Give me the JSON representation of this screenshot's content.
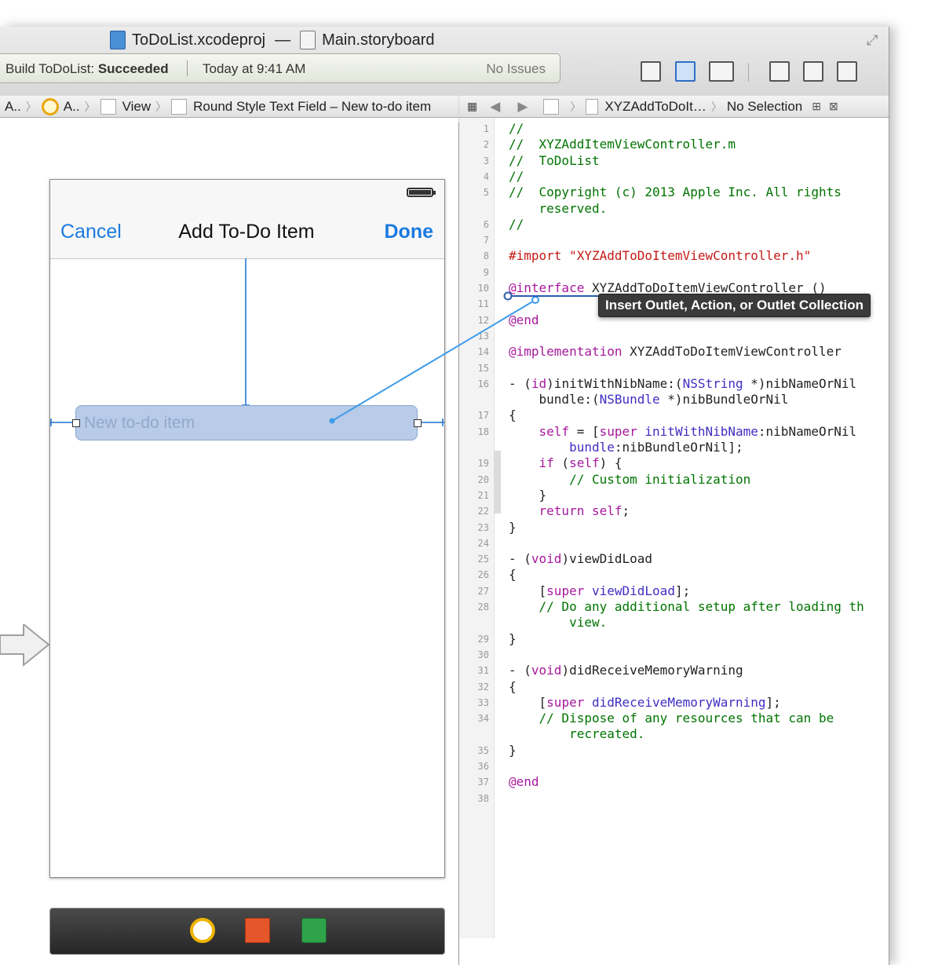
{
  "title": {
    "project": "ToDoList.xcodeproj",
    "separator": "—",
    "file": "Main.storyboard"
  },
  "activity": {
    "build_prefix": "Build ToDoList: ",
    "build_status": "Succeeded",
    "time": "Today at 9:41 AM",
    "issues": "No Issues"
  },
  "jumpbar_left": {
    "items": [
      "A..",
      "A..",
      "View",
      "Round Style Text Field – New to-do item"
    ]
  },
  "jumpbar_right": {
    "file": "XYZAddToDoIt…",
    "selection": "No Selection"
  },
  "scene": {
    "cancel": "Cancel",
    "title": "Add To-Do Item",
    "done": "Done",
    "textfield_placeholder": "New to-do item"
  },
  "tooltip": "Insert Outlet, Action, or Outlet Collection",
  "colors": {
    "keyword": "#a6199c",
    "string": "#c41a16",
    "comment": "#007400",
    "type": "#3f2ec2",
    "link": "#1a7ae0"
  },
  "code": [
    {
      "n": "1",
      "t": [
        {
          "s": "//",
          "c": "comment"
        }
      ]
    },
    {
      "n": "2",
      "t": [
        {
          "s": "//  XYZAddItemViewController.m",
          "c": "comment"
        }
      ]
    },
    {
      "n": "3",
      "t": [
        {
          "s": "//  ToDoList",
          "c": "comment"
        }
      ]
    },
    {
      "n": "4",
      "t": [
        {
          "s": "//",
          "c": "comment"
        }
      ]
    },
    {
      "n": "5",
      "t": [
        {
          "s": "//  Copyright (c) 2013 Apple Inc. All rights",
          "c": "comment"
        }
      ]
    },
    {
      "n": "",
      "t": [
        {
          "s": "    reserved.",
          "c": "comment"
        }
      ]
    },
    {
      "n": "6",
      "t": [
        {
          "s": "//",
          "c": "comment"
        }
      ]
    },
    {
      "n": "7",
      "t": []
    },
    {
      "n": "8",
      "t": [
        {
          "s": "#import ",
          "c": "string"
        },
        {
          "s": "\"XYZAddToDoItemViewController.h\"",
          "c": "string"
        }
      ]
    },
    {
      "n": "9",
      "t": []
    },
    {
      "n": "10",
      "t": [
        {
          "s": "@interface",
          "c": "keyword"
        },
        {
          "s": " XYZAddToDoItemViewController ()",
          "c": "plain"
        }
      ]
    },
    {
      "n": "11",
      "t": []
    },
    {
      "n": "12",
      "t": [
        {
          "s": "@end",
          "c": "keyword"
        }
      ]
    },
    {
      "n": "13",
      "t": []
    },
    {
      "n": "14",
      "t": [
        {
          "s": "@implementation",
          "c": "keyword"
        },
        {
          "s": " XYZAddToDoItemViewController",
          "c": "plain"
        }
      ]
    },
    {
      "n": "15",
      "t": []
    },
    {
      "n": "16",
      "t": [
        {
          "s": "- (",
          "c": "plain"
        },
        {
          "s": "id",
          "c": "keyword"
        },
        {
          "s": ")initWithNibName:(",
          "c": "plain"
        },
        {
          "s": "NSString",
          "c": "type"
        },
        {
          "s": " *)nibNameOrNil",
          "c": "plain"
        }
      ]
    },
    {
      "n": "",
      "t": [
        {
          "s": "    bundle:(",
          "c": "plain"
        },
        {
          "s": "NSBundle",
          "c": "type"
        },
        {
          "s": " *)nibBundleOrNil",
          "c": "plain"
        }
      ]
    },
    {
      "n": "17",
      "t": [
        {
          "s": "{",
          "c": "plain"
        }
      ]
    },
    {
      "n": "18",
      "t": [
        {
          "s": "    ",
          "c": "plain"
        },
        {
          "s": "self",
          "c": "keyword"
        },
        {
          "s": " = [",
          "c": "plain"
        },
        {
          "s": "super",
          "c": "keyword"
        },
        {
          "s": " ",
          "c": "plain"
        },
        {
          "s": "initWithNibName",
          "c": "type"
        },
        {
          "s": ":nibNameOrNil",
          "c": "plain"
        }
      ]
    },
    {
      "n": "",
      "t": [
        {
          "s": "        ",
          "c": "plain"
        },
        {
          "s": "bundle",
          "c": "type"
        },
        {
          "s": ":nibBundleOrNil];",
          "c": "plain"
        }
      ]
    },
    {
      "n": "19",
      "t": [
        {
          "s": "    ",
          "c": "plain"
        },
        {
          "s": "if",
          "c": "keyword"
        },
        {
          "s": " (",
          "c": "plain"
        },
        {
          "s": "self",
          "c": "keyword"
        },
        {
          "s": ") {",
          "c": "plain"
        }
      ]
    },
    {
      "n": "20",
      "t": [
        {
          "s": "        // Custom initialization",
          "c": "comment"
        }
      ]
    },
    {
      "n": "21",
      "t": [
        {
          "s": "    }",
          "c": "plain"
        }
      ]
    },
    {
      "n": "22",
      "t": [
        {
          "s": "    ",
          "c": "plain"
        },
        {
          "s": "return",
          "c": "keyword"
        },
        {
          "s": " ",
          "c": "plain"
        },
        {
          "s": "self",
          "c": "keyword"
        },
        {
          "s": ";",
          "c": "plain"
        }
      ]
    },
    {
      "n": "23",
      "t": [
        {
          "s": "}",
          "c": "plain"
        }
      ]
    },
    {
      "n": "24",
      "t": []
    },
    {
      "n": "25",
      "t": [
        {
          "s": "- (",
          "c": "plain"
        },
        {
          "s": "void",
          "c": "keyword"
        },
        {
          "s": ")viewDidLoad",
          "c": "plain"
        }
      ]
    },
    {
      "n": "26",
      "t": [
        {
          "s": "{",
          "c": "plain"
        }
      ]
    },
    {
      "n": "27",
      "t": [
        {
          "s": "    [",
          "c": "plain"
        },
        {
          "s": "super",
          "c": "keyword"
        },
        {
          "s": " ",
          "c": "plain"
        },
        {
          "s": "viewDidLoad",
          "c": "type"
        },
        {
          "s": "];",
          "c": "plain"
        }
      ]
    },
    {
      "n": "28",
      "t": [
        {
          "s": "    // Do any additional setup after loading th",
          "c": "comment"
        }
      ]
    },
    {
      "n": "",
      "t": [
        {
          "s": "        view.",
          "c": "comment"
        }
      ]
    },
    {
      "n": "29",
      "t": [
        {
          "s": "}",
          "c": "plain"
        }
      ]
    },
    {
      "n": "30",
      "t": []
    },
    {
      "n": "31",
      "t": [
        {
          "s": "- (",
          "c": "plain"
        },
        {
          "s": "void",
          "c": "keyword"
        },
        {
          "s": ")didReceiveMemoryWarning",
          "c": "plain"
        }
      ]
    },
    {
      "n": "32",
      "t": [
        {
          "s": "{",
          "c": "plain"
        }
      ]
    },
    {
      "n": "33",
      "t": [
        {
          "s": "    [",
          "c": "plain"
        },
        {
          "s": "super",
          "c": "keyword"
        },
        {
          "s": " ",
          "c": "plain"
        },
        {
          "s": "didReceiveMemoryWarning",
          "c": "type"
        },
        {
          "s": "];",
          "c": "plain"
        }
      ]
    },
    {
      "n": "34",
      "t": [
        {
          "s": "    // Dispose of any resources that can be",
          "c": "comment"
        }
      ]
    },
    {
      "n": "",
      "t": [
        {
          "s": "        recreated.",
          "c": "comment"
        }
      ]
    },
    {
      "n": "35",
      "t": [
        {
          "s": "}",
          "c": "plain"
        }
      ]
    },
    {
      "n": "36",
      "t": []
    },
    {
      "n": "37",
      "t": [
        {
          "s": "@end",
          "c": "keyword"
        }
      ]
    },
    {
      "n": "38",
      "t": []
    }
  ]
}
